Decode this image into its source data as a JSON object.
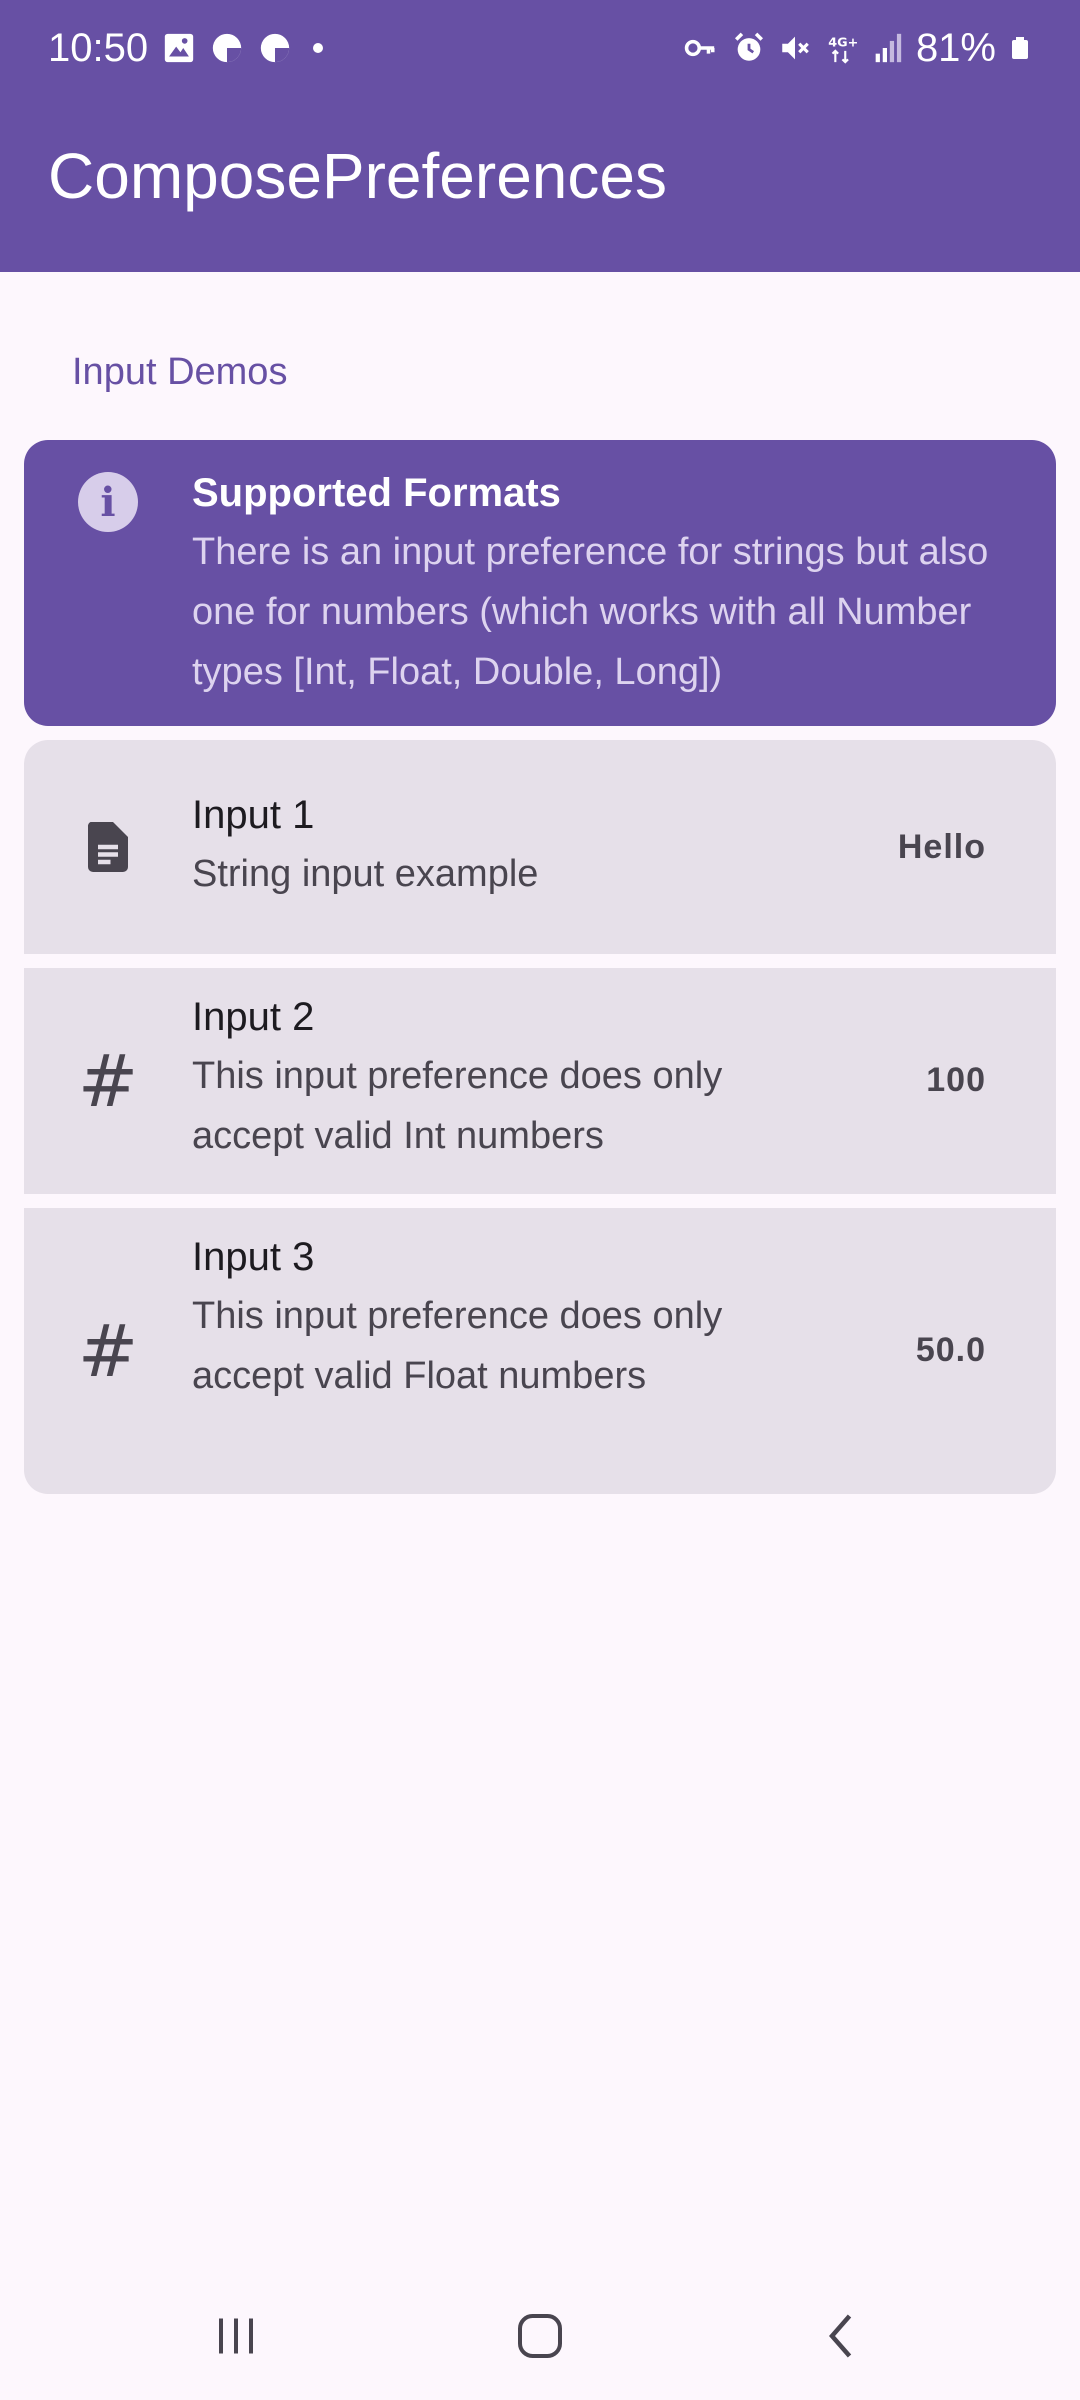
{
  "status_bar": {
    "time": "10:50",
    "battery": "81%",
    "left_icons": [
      "gallery-icon",
      "pie-app-icon",
      "pie-app-icon",
      "dot-icon"
    ],
    "right_icons": [
      "vpn-key-icon",
      "alarm-icon",
      "mute-icon",
      "network-4g-icon",
      "signal-icon",
      "battery-icon"
    ]
  },
  "app_bar": {
    "title": "ComposePreferences"
  },
  "section": {
    "title": "Input Demos"
  },
  "info_card": {
    "icon": "info-icon",
    "title": "Supported Formats",
    "text": "There is an input preference for strings but also one for numbers (which works with all Number types [Int, Float, Double, Long])"
  },
  "preferences": [
    {
      "icon": "document-icon",
      "title": "Input 1",
      "summary": "String input example",
      "value": "Hello"
    },
    {
      "icon": "hash-icon",
      "title": "Input 2",
      "summary": "This input preference does only accept valid Int numbers",
      "value": "100"
    },
    {
      "icon": "hash-icon",
      "title": "Input 3",
      "summary": "This input preference does only accept valid Float numbers",
      "value": "50.0"
    }
  ],
  "nav_bar": {
    "buttons": [
      "recents-icon",
      "home-icon",
      "back-icon"
    ]
  },
  "colors": {
    "primary": "#6750a4",
    "background": "#fdf7fd",
    "surface_variant": "#e6e0e9",
    "on_surface": "#1d1b20",
    "on_surface_variant": "#49454f"
  }
}
